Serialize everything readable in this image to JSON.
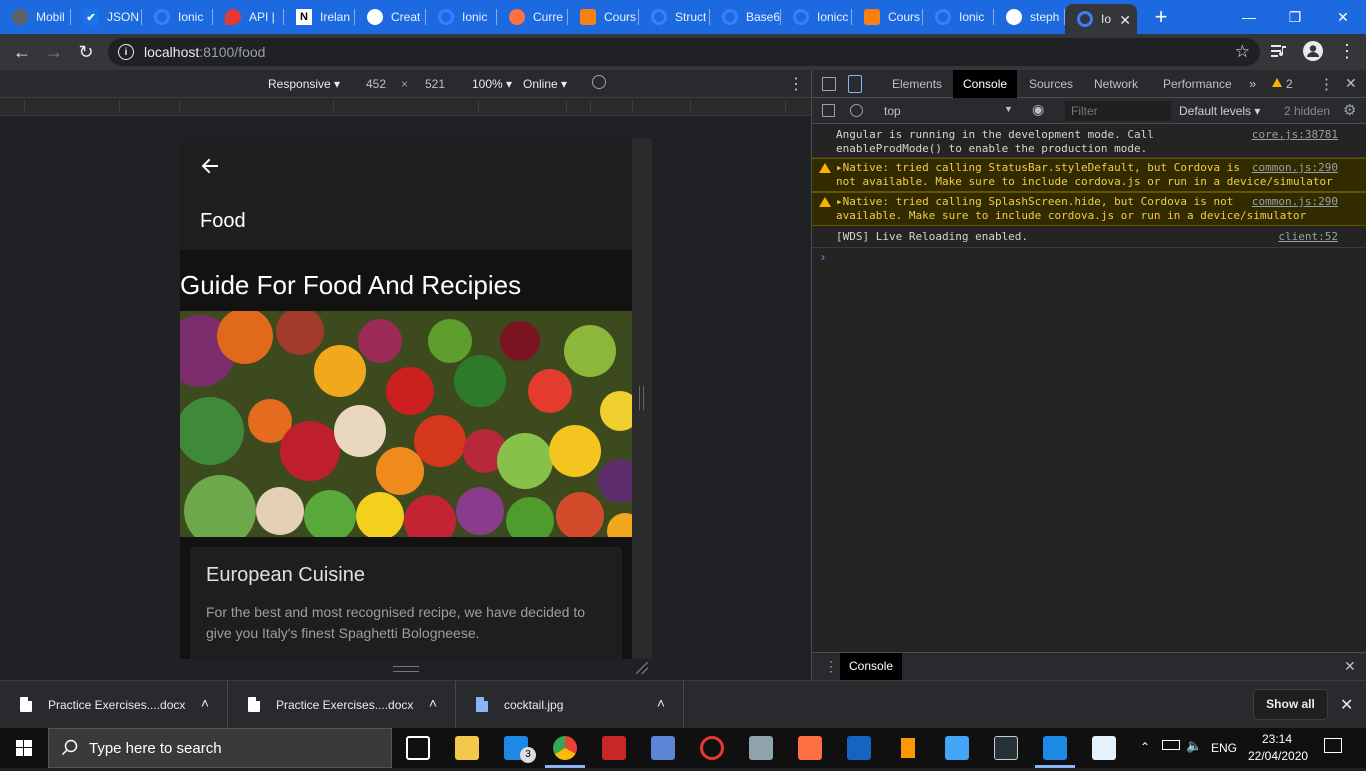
{
  "tabs": [
    {
      "label": "Mobil",
      "icon": "globe-icon",
      "color": "#5f6368"
    },
    {
      "label": "JSON",
      "icon": "checkmark-icon",
      "color": "#ffffff"
    },
    {
      "label": "Ionic",
      "icon": "ionic-icon",
      "color": "#3880ff"
    },
    {
      "label": "API | ",
      "icon": "pin-icon",
      "color": "#e53935"
    },
    {
      "label": "Irelan",
      "icon": "n-icon",
      "color": "#ffffff"
    },
    {
      "label": "Creat",
      "icon": "github-icon",
      "color": "#ffffff"
    },
    {
      "label": "Ionic",
      "icon": "ionic-icon",
      "color": "#3880ff"
    },
    {
      "label": "Curre",
      "icon": "circle-icon",
      "color": "#ff7043"
    },
    {
      "label": "Cours",
      "icon": "moodle-icon",
      "color": "#f98012"
    },
    {
      "label": "Struct",
      "icon": "ionic-icon",
      "color": "#3880ff"
    },
    {
      "label": "Base6",
      "icon": "ionic-icon",
      "color": "#3880ff"
    },
    {
      "label": "Ionicc",
      "icon": "ionic-icon",
      "color": "#3880ff"
    },
    {
      "label": "Cours",
      "icon": "moodle-icon",
      "color": "#f98012"
    },
    {
      "label": "Ionic",
      "icon": "ionic-icon",
      "color": "#3880ff"
    },
    {
      "label": "steph",
      "icon": "github-icon",
      "color": "#ffffff"
    },
    {
      "label": "Io",
      "icon": "ionic-icon",
      "color": "#3880ff",
      "active": true
    }
  ],
  "address": {
    "host": "localhost",
    "path": ":8100/food"
  },
  "device_toolbar": {
    "mode": "Responsive",
    "width": "452",
    "times": "×",
    "height": "521",
    "zoom": "100%",
    "network": "Online"
  },
  "app": {
    "header_title": "Food",
    "page_heading": "Guide For Food And Recipies",
    "card": {
      "title": "European Cuisine",
      "text": "For the best and most recognised recipe, we have decided to give you Italy's finest Spaghetti Bologneese."
    }
  },
  "devtools": {
    "tabs": [
      "Elements",
      "Console",
      "Sources",
      "Network",
      "Performance"
    ],
    "active_tab": "Console",
    "more": "»",
    "warnings_count": "2",
    "context": "top",
    "filter_placeholder": "Filter",
    "levels": "Default levels",
    "hidden": "2 hidden",
    "logs": [
      {
        "type": "log",
        "text": "Angular is running in the development mode. Call\nenableProdMode() to enable the production mode.",
        "source": "core.js:38781"
      },
      {
        "type": "warn",
        "text": "▸Native: tried calling StatusBar.styleDefault, but Cordova is\nnot available. Make sure to include cordova.js or run in a device/simulator",
        "source": "common.js:290"
      },
      {
        "type": "warn",
        "text": "▸Native: tried calling SplashScreen.hide, but Cordova is not\navailable. Make sure to include cordova.js or run in a device/simulator",
        "source": "common.js:290"
      },
      {
        "type": "log",
        "text": "[WDS] Live Reloading enabled.",
        "source": "client:52"
      }
    ],
    "prompt": "›",
    "drawer_tab": "Console"
  },
  "downloads": {
    "items": [
      {
        "name": "Practice Exercises....docx"
      },
      {
        "name": "Practice Exercises....docx"
      },
      {
        "name": "cocktail.jpg"
      }
    ],
    "show_all": "Show all"
  },
  "taskbar": {
    "search_placeholder": "Type here to search",
    "mail_badge": "3",
    "language": "ENG",
    "time": "23:14",
    "date": "22/04/2020"
  }
}
